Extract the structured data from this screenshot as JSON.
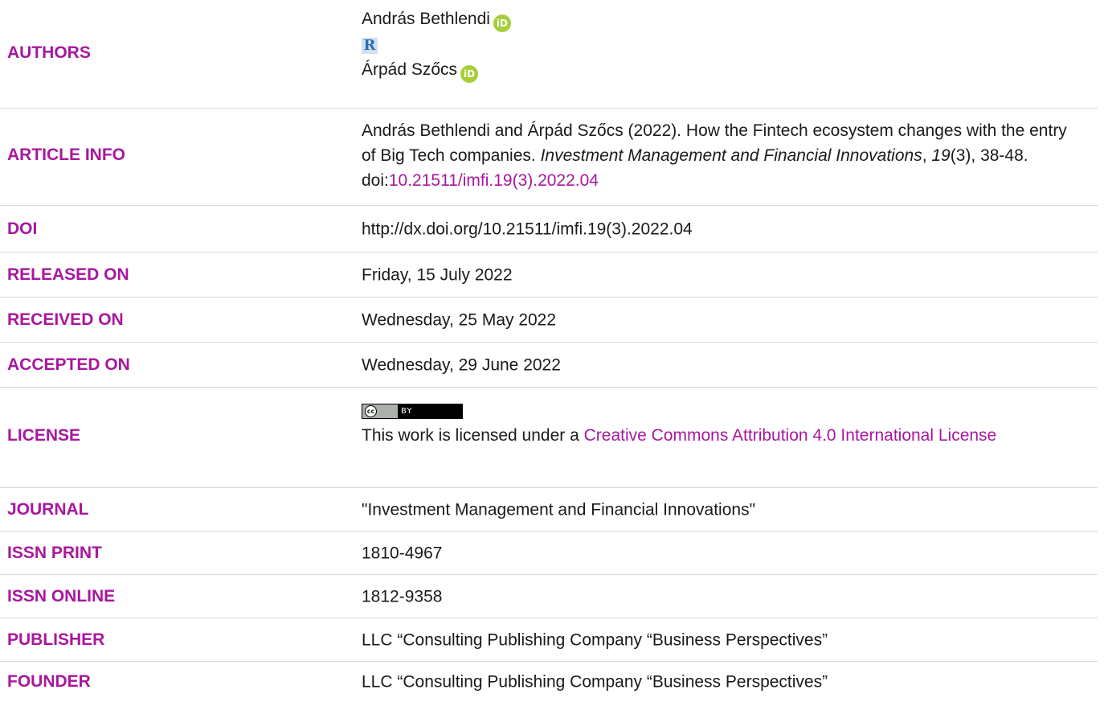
{
  "authors": {
    "label": "AUTHORS",
    "list": [
      {
        "name": "András Bethlendi",
        "orcid_icon": "iD"
      },
      {
        "name": "Árpád Szőcs",
        "orcid_icon": "iD"
      }
    ],
    "researcher_icon": "R"
  },
  "article_info": {
    "label": "ARTICLE INFO",
    "citation_prefix": "András Bethlendi and Árpád Szőcs (2022). How the Fintech ecosystem changes with the entry of Big Tech companies. ",
    "journal_italic": "Investment Management and Financial Innovations",
    "sep": ", ",
    "volume_italic": "19",
    "issue_pages": "(3), 38-48. doi:",
    "doi_link": "10.21511/imfi.19(3).2022.04"
  },
  "doi": {
    "label": "DOI",
    "value": "http://dx.doi.org/10.21511/imfi.19(3).2022.04"
  },
  "released": {
    "label": "RELEASED ON",
    "value": "Friday, 15 July 2022"
  },
  "received": {
    "label": "RECEIVED ON",
    "value": "Wednesday, 25 May 2022"
  },
  "accepted": {
    "label": "ACCEPTED ON",
    "value": "Wednesday, 29 June 2022"
  },
  "license": {
    "label": "LICENSE",
    "badge_cc": "cc",
    "badge_by": "BY",
    "text_prefix": "This work is licensed under a ",
    "link_text": "Creative Commons Attribution 4.0 International License"
  },
  "journal": {
    "label": "JOURNAL",
    "value": "\"Investment Management and Financial Innovations\""
  },
  "issn_print": {
    "label": "ISSN PRINT",
    "value": "1810-4967"
  },
  "issn_online": {
    "label": "ISSN ONLINE",
    "value": "1812-9358"
  },
  "publisher": {
    "label": "PUBLISHER",
    "value": "LLC “Consulting Publishing Company “Business Perspectives”"
  },
  "founder": {
    "label": "FOUNDER",
    "value": "LLC “Consulting Publishing Company “Business Perspectives”"
  },
  "colors": {
    "label": "#a8179e",
    "link": "#a8179e",
    "rule": "#d6d6d6",
    "orcid": "#a6ce39"
  }
}
